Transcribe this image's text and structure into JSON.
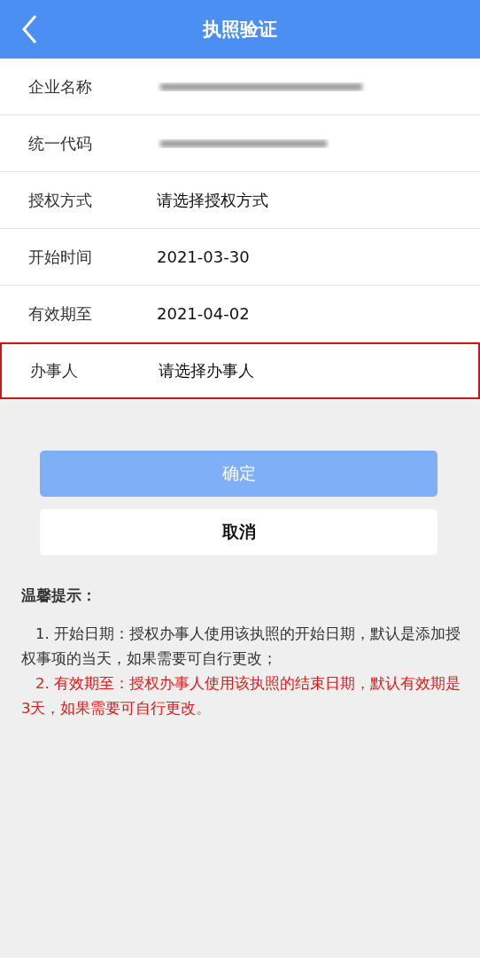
{
  "header": {
    "title": "执照验证"
  },
  "rows": [
    {
      "label": "企业名称",
      "kind": "redacted",
      "highlighted": false
    },
    {
      "label": "统一代码",
      "kind": "redacted",
      "highlighted": false
    },
    {
      "label": "授权方式",
      "kind": "select",
      "placeholder": "请选择授权方式",
      "highlighted": false
    },
    {
      "label": "开始时间",
      "kind": "value",
      "value": "2021-03-30",
      "highlighted": false
    },
    {
      "label": "有效期至",
      "kind": "value",
      "value": "2021-04-02",
      "highlighted": false
    },
    {
      "label": "办事人",
      "kind": "select",
      "placeholder": "请选择办事人",
      "highlighted": true
    }
  ],
  "buttons": [
    {
      "label": "确定",
      "kind": "primary",
      "disabled": true
    },
    {
      "label": "取消",
      "kind": "secondary",
      "disabled": false
    }
  ],
  "tips": {
    "title": "温馨提示：",
    "items": [
      {
        "text": "1. 开始日期：授权办事人使用该执照的开始日期，默认是添加授权事项的当天，如果需要可自行更改；",
        "emphasis": false
      },
      {
        "text": "2. 有效期至：授权办事人使用该执照的结束日期，默认有效期是3天，如果需要可自行更改。",
        "emphasis": true
      }
    ]
  }
}
